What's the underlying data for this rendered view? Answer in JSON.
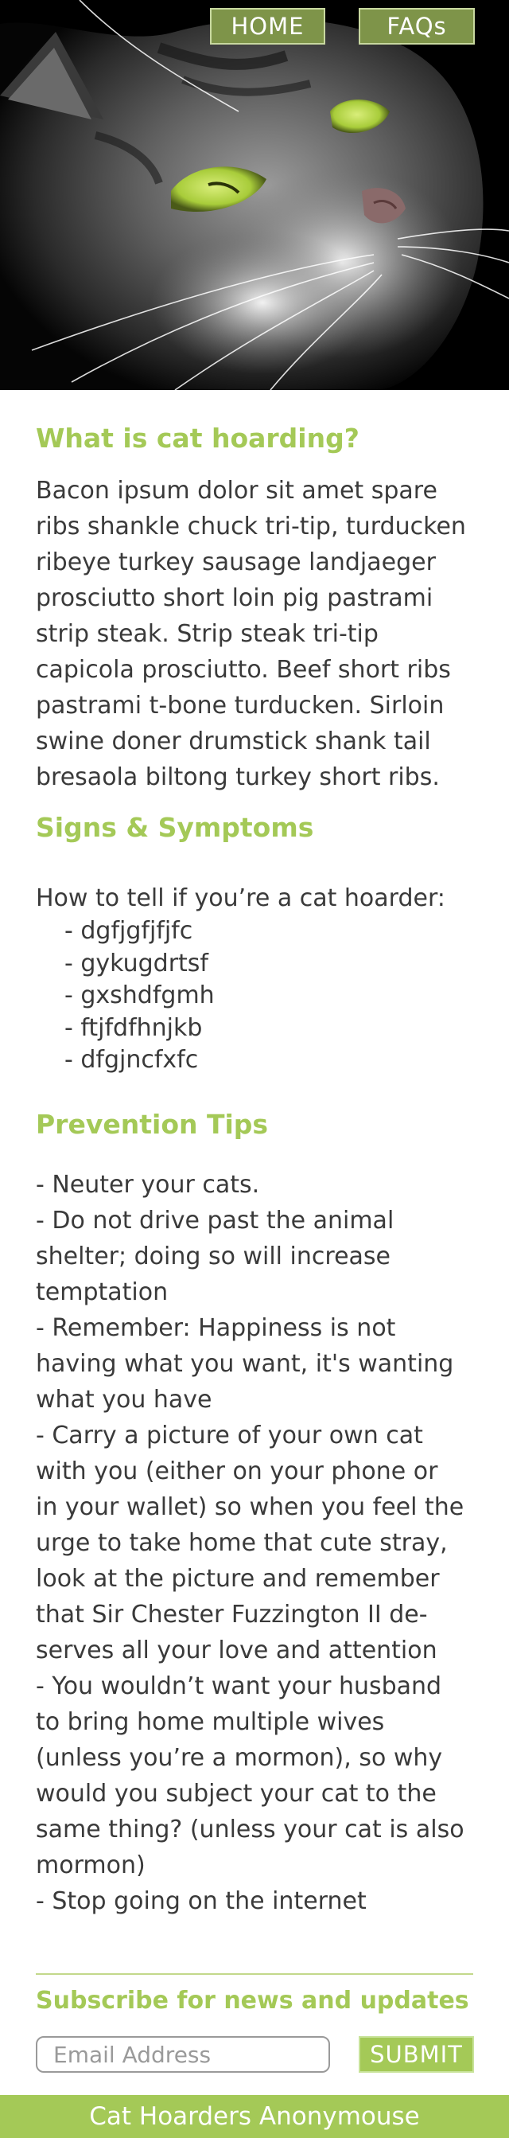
{
  "nav": {
    "home_label": "HOME",
    "faqs_label": "FAQs"
  },
  "section1": {
    "title": "What is cat hoarding?",
    "lines": [
      "Bacon ipsum dolor sit amet spare",
      "ribs shankle chuck tri-tip, turducken",
      "ribeye turkey sausage landjaeger",
      "prosciutto short loin pig pastrami",
      "strip steak. Strip steak tri-tip",
      "capicola prosciutto. Beef short ribs",
      "pastrami t-bone turducken. Sirloin",
      "swine doner drumstick shank tail",
      "bresaola biltong turkey short ribs."
    ]
  },
  "section2": {
    "title": "Signs & Symptoms",
    "intro": "How to tell if you’re a cat hoarder:",
    "items": [
      "- dgfjgfjfjfc",
      "- gykugdrtsf",
      "- gxshdfgmh",
      "- ftjfdfhnjkb",
      "- dfgjncfxfc"
    ]
  },
  "section3": {
    "title": "Prevention Tips",
    "lines": [
      "- Neuter your cats.",
      "- Do not drive past the animal",
      "shelter; doing so will increase",
      "temptation",
      "- Remember: Happiness is not",
      "having what you want, it's wanting",
      "what you have",
      "- Carry a picture of your own cat",
      "with you (either on your phone or",
      "in your wallet) so when you feel the",
      "urge to take home that cute stray,",
      "look at the picture and remember",
      "that Sir Chester Fuzzington II de-",
      "serves all your love and attention",
      "- You wouldn’t want your husband",
      "to bring home multiple wives",
      "(unless you’re a mormon), so why",
      "would you subject your cat to the",
      "same thing? (unless your cat is also",
      "mormon)",
      "- Stop going on the internet"
    ]
  },
  "subscribe": {
    "title": "Subscribe for news and updates",
    "email_placeholder": "Email Address",
    "email_value": "",
    "submit_label": "SUBMIT"
  },
  "footer": {
    "text": "Cat Hoarders Anonymouse"
  },
  "colors": {
    "accent": "#a4c957",
    "nav_button": "#7e9449",
    "text": "#3a3a3a",
    "cat_eye": "#b5d647"
  }
}
